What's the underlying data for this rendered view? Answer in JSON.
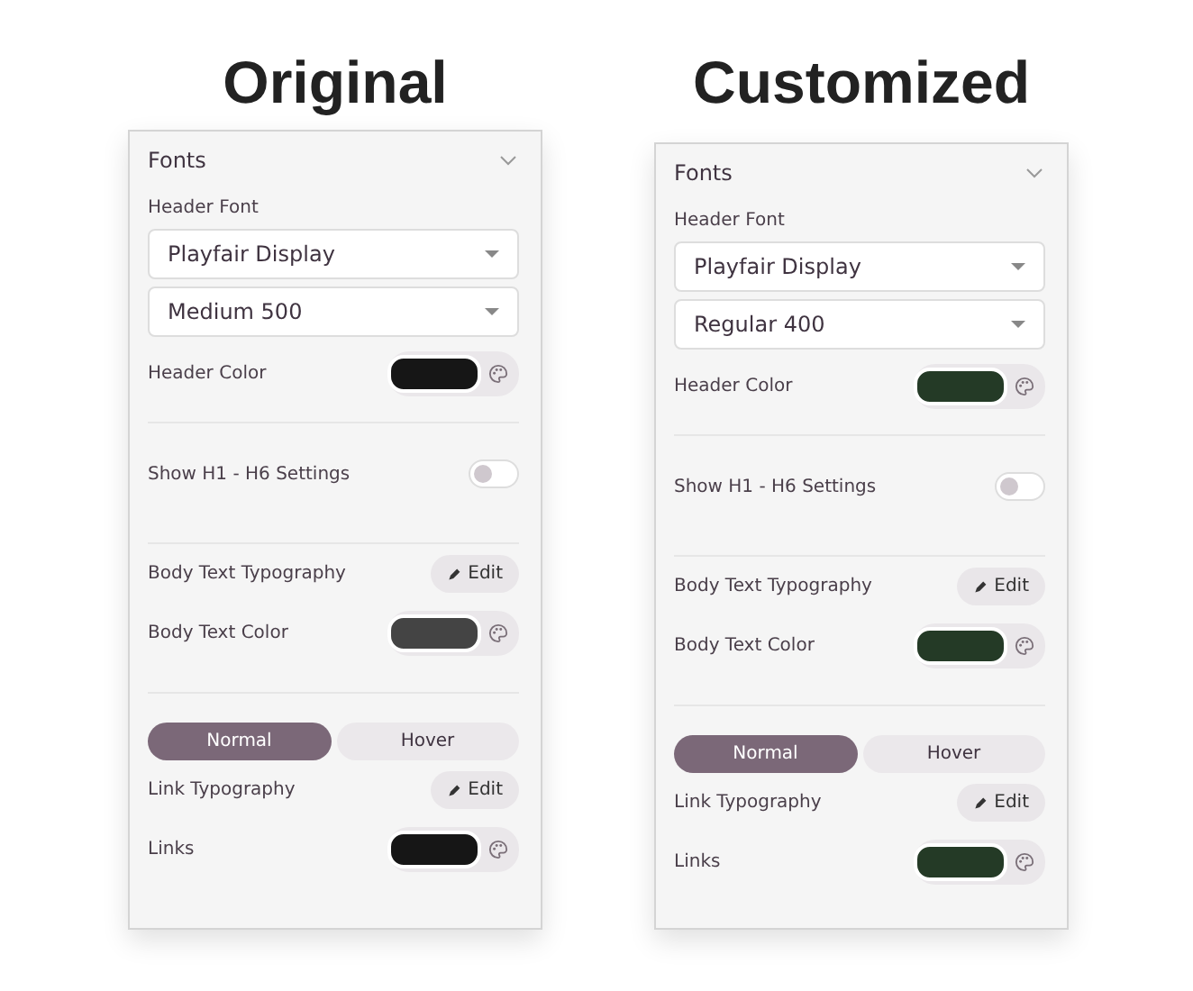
{
  "panels": [
    {
      "heading": "Original",
      "title": "Fonts",
      "expanded": true,
      "header_font_label": "Header Font",
      "font_family": "Playfair Display",
      "font_weight": "Medium 500",
      "header_color": {
        "label": "Header Color",
        "color": "#161616"
      },
      "h_settings": {
        "label": "Show H1 - H6 Settings",
        "on": false
      },
      "body_typography": {
        "label": "Body Text Typography",
        "button": "Edit"
      },
      "body_color": {
        "label": "Body Text Color",
        "color": "#444444"
      },
      "tabs": [
        {
          "label": "Normal",
          "selected": true
        },
        {
          "label": "Hover",
          "selected": false
        }
      ],
      "link_typography": {
        "label": "Link Typography",
        "button": "Edit"
      },
      "links_color": {
        "label": "Links",
        "color": "#161616"
      }
    },
    {
      "heading": "Customized",
      "title": "Fonts",
      "expanded": true,
      "header_font_label": "Header Font",
      "font_family": "Playfair Display",
      "font_weight": "Regular 400",
      "header_color": {
        "label": "Header Color",
        "color": "#243a26"
      },
      "h_settings": {
        "label": "Show H1 - H6 Settings",
        "on": false
      },
      "body_typography": {
        "label": "Body Text Typography",
        "button": "Edit"
      },
      "body_color": {
        "label": "Body Text Color",
        "color": "#243a26"
      },
      "tabs": [
        {
          "label": "Normal",
          "selected": true
        },
        {
          "label": "Hover",
          "selected": false
        }
      ],
      "link_typography": {
        "label": "Link Typography",
        "button": "Edit"
      },
      "links_color": {
        "label": "Links",
        "color": "#243a26"
      }
    }
  ]
}
